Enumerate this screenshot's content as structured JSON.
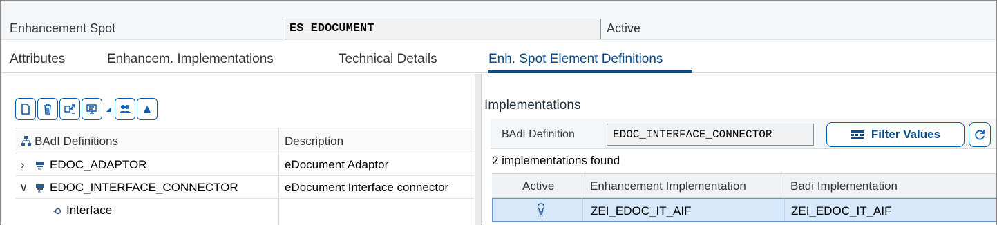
{
  "header": {
    "label": "Enhancement Spot",
    "value": "ES_EDOCUMENT",
    "status": "Active"
  },
  "tabs": [
    {
      "label": "Attributes",
      "active": false
    },
    {
      "label": "Enhancem. Implementations",
      "active": false
    },
    {
      "label": "Technical Details",
      "active": false
    },
    {
      "label": "Enh. Spot Element Definitions",
      "active": true
    }
  ],
  "toolbar": {
    "icons": [
      "create-icon",
      "delete-icon",
      "change-icon",
      "display-dropdown-icon",
      "users-icon",
      "up-icon"
    ]
  },
  "tree": {
    "col_definitions": "BAdI Definitions",
    "col_description": "Description",
    "rows": [
      {
        "name": "EDOC_ADAPTOR",
        "description": "eDocument Adaptor",
        "expanded": false
      },
      {
        "name": "EDOC_INTERFACE_CONNECTOR",
        "description": "eDocument Interface connector",
        "expanded": true
      },
      {
        "name": "Interface",
        "description": "",
        "child": true
      }
    ]
  },
  "implementations": {
    "title": "Implementations",
    "badi_label": "BAdI Definition",
    "badi_value": "EDOC_INTERFACE_CONNECTOR",
    "filter_button": "Filter Values",
    "found_text": "2  implementations found",
    "columns": [
      "Active",
      "Enhancement Implementation",
      "Badi Implementation"
    ],
    "rows": [
      {
        "active_icon": "bulb-icon",
        "enhancement": "ZEI_EDOC_IT_AIF",
        "badi": "ZEI_EDOC_IT_AIF"
      }
    ]
  },
  "colors": {
    "accent": "#0a4b8c",
    "selection": "#d6e8fb"
  }
}
